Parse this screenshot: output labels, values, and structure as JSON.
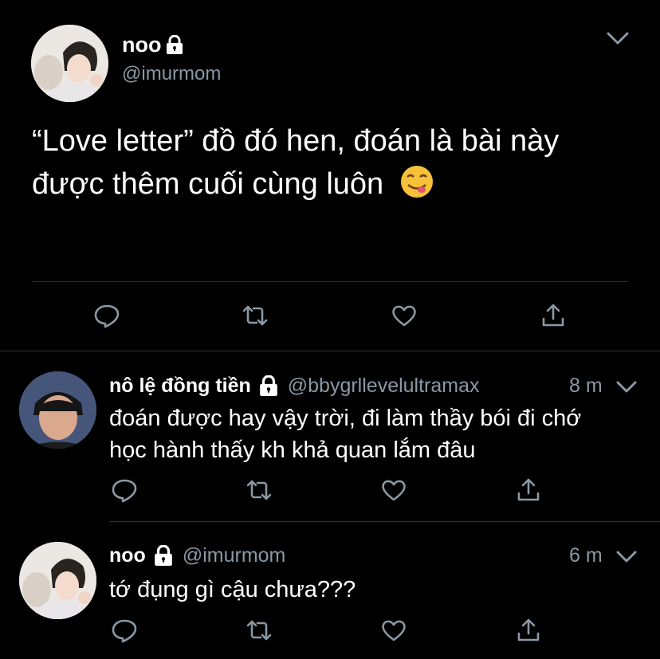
{
  "main_tweet": {
    "display_name": "noo",
    "handle": "@imurmom",
    "text_line1": "“Love letter” đồ đó hen, đoán là bài này",
    "text_line2": "được thêm cuối cùng luôn",
    "emoji": "😋"
  },
  "replies": [
    {
      "display_name": "nô lệ đồng tiền",
      "handle": "@bbygrllevelultramax",
      "time": "8 m",
      "text_line1": "đoán được hay vậy trời, đi làm thầy bói đi chớ",
      "text_line2": "học hành thấy kh khả quan lắm đâu"
    },
    {
      "display_name": "noo",
      "handle": "@imurmom",
      "time": "6 m",
      "text_line1": "tớ đụng gì cậu chưa???"
    }
  ],
  "icons": {
    "reply": "reply-icon",
    "retweet": "retweet-icon",
    "like": "heart-icon",
    "share": "share-icon",
    "lock": "lock-icon",
    "menu": "chevron-down-icon"
  },
  "colors": {
    "background": "#000000",
    "text": "#ffffff",
    "muted": "#8b98a5",
    "divider": "#2f3336"
  }
}
